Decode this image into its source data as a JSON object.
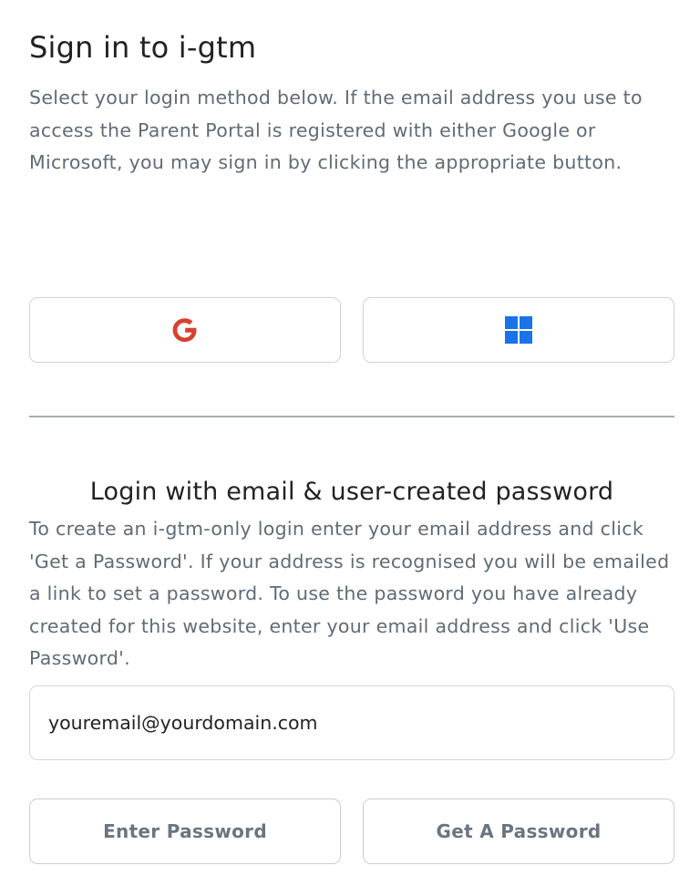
{
  "header": {
    "title": "Sign in to i-gtm",
    "intro": "Select your login method below. If the email address you use to access the Parent Portal is registered with either Google or Microsoft, you may sign in by clicking the appropriate button."
  },
  "sso": {
    "google_icon": "google-g-icon",
    "microsoft_icon": "windows-logo-icon",
    "google_color": "#d8412f",
    "microsoft_color": "#1a73e8"
  },
  "email_login": {
    "title": "Login with email & user-created password",
    "description": "To create an i-gtm-only login enter your email address and click 'Get a Password'. If your address is recognised you will be emailed a link to set a password. To use the password you have already created for this website, enter your email address and click 'Use Password'.",
    "email_placeholder": "youremail@yourdomain.com",
    "email_value": "",
    "enter_password_label": "Enter Password",
    "get_password_label": "Get A Password"
  }
}
